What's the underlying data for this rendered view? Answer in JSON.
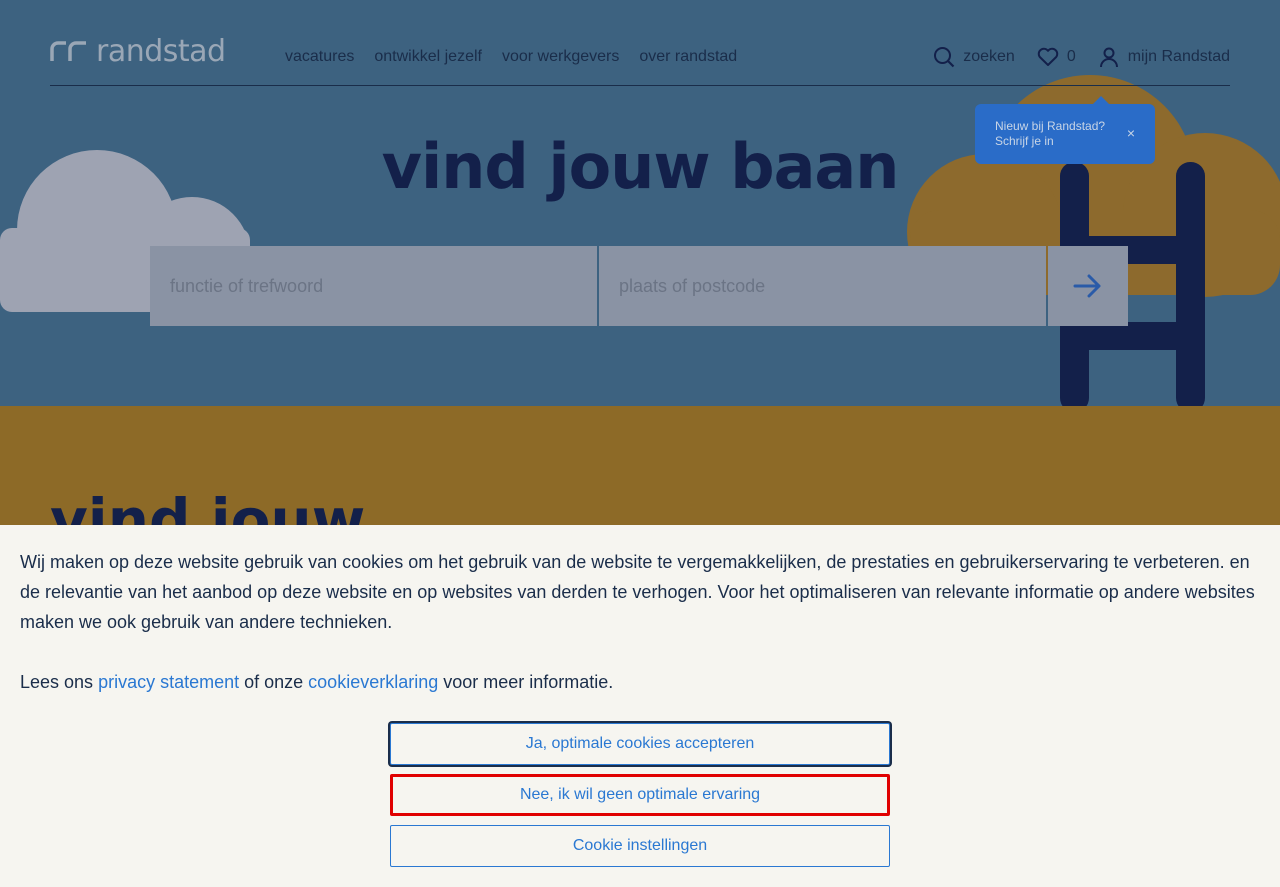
{
  "header": {
    "logo_text": "randstad",
    "nav": [
      "vacatures",
      "ontwikkel jezelf",
      "voor werkgevers",
      "over randstad"
    ],
    "search_label": "zoeken",
    "favorites_count": "0",
    "account_label": "mijn Randstad"
  },
  "tooltip": {
    "line1": "Nieuw bij Randstad?",
    "line2": "Schrijf je in",
    "close": "×"
  },
  "hero": {
    "title": "vind jouw baan",
    "job_placeholder": "functie of trefwoord",
    "location_placeholder": "plaats of postcode"
  },
  "band": {
    "title": "vind jouw"
  },
  "cookie": {
    "text": "Wij maken op deze website gebruik van cookies om het gebruik van de website te vergemakkelijken, de prestaties en gebruikerservaring te verbeteren. en de relevantie van het aanbod op deze website en op websites van derden te verhogen. Voor het optimaliseren van relevante informatie op andere websites maken we ook gebruik van andere technieken.",
    "read_prefix": "Lees ons ",
    "privacy_link": "privacy statement",
    "middle": " of onze ",
    "cookie_link": "cookieverklaring",
    "read_suffix": " voor meer informatie.",
    "accept_button": "Ja, optimale cookies accepteren",
    "decline_button": "Nee, ik wil geen optimale ervaring",
    "settings_button": "Cookie instellingen"
  },
  "colors": {
    "hero_bg": "#3d6280",
    "navy": "#13204a",
    "band_bg": "#8d6a27",
    "link_blue": "#2a78d2",
    "highlight_red": "#e00000"
  }
}
